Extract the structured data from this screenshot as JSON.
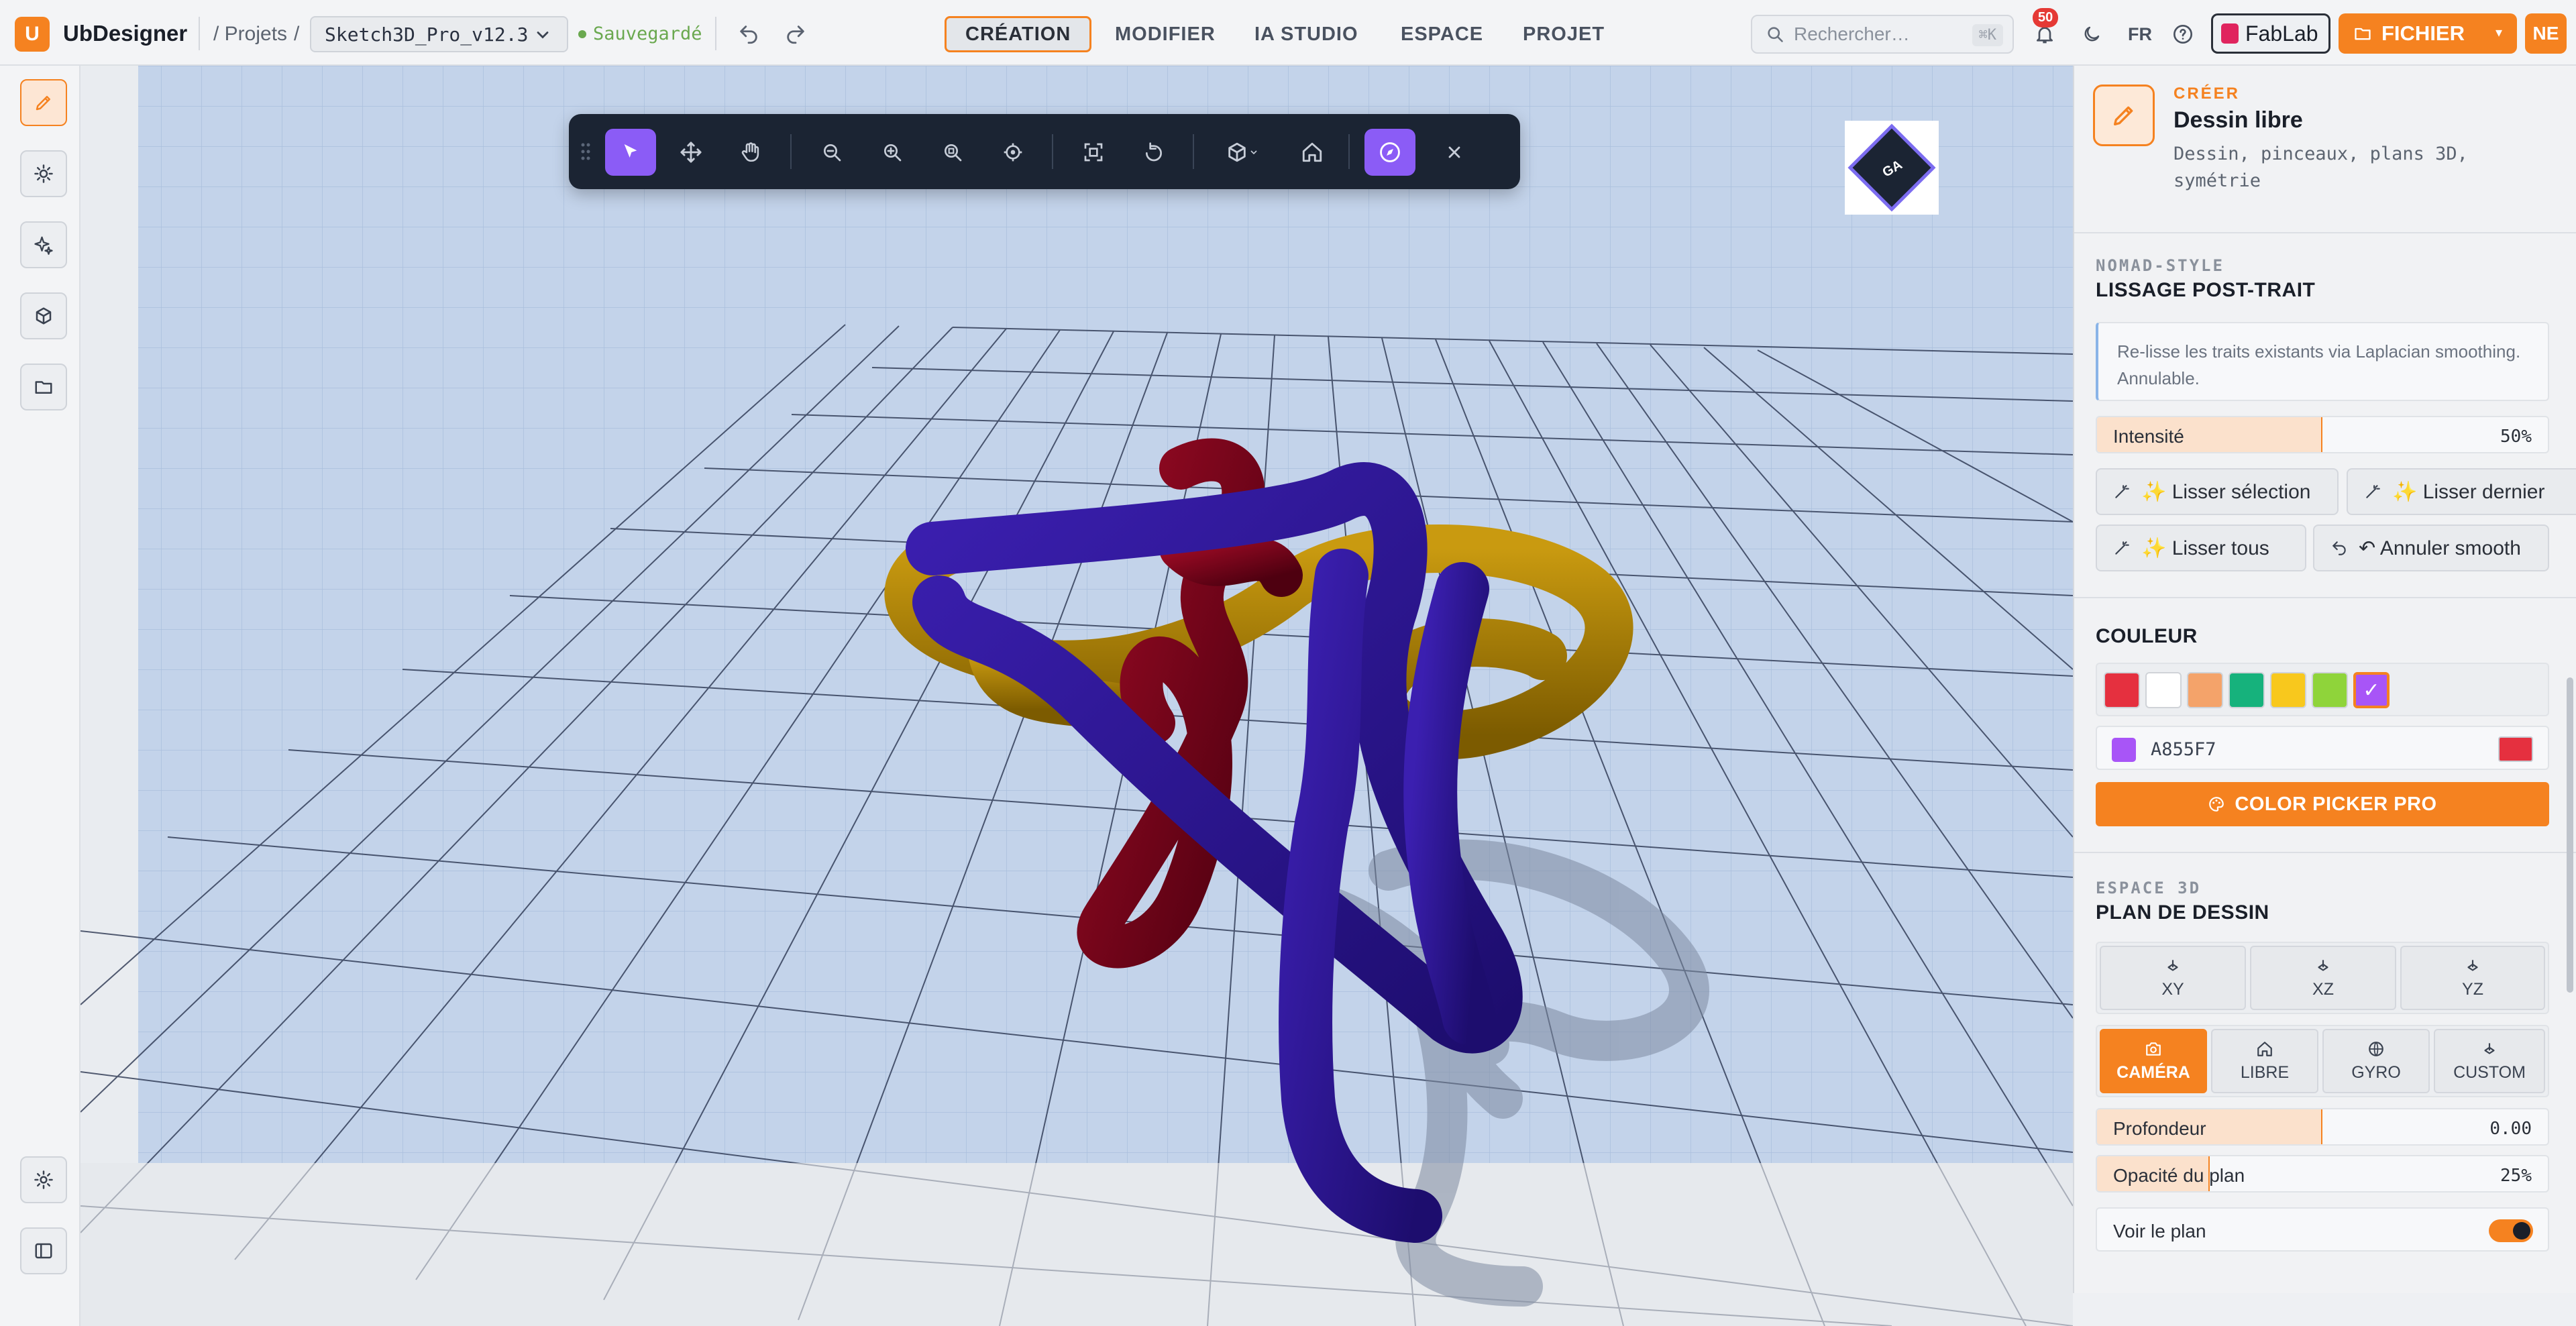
{
  "app": {
    "logo_letter": "U",
    "name": "UbDesigner"
  },
  "breadcrumb": {
    "projects": "/ Projets",
    "sep": "/"
  },
  "file": {
    "name": "Sketch3D_Pro_v12.3",
    "status": "Sauvegardé"
  },
  "nav_tabs": [
    {
      "label": "CRÉATION",
      "active": true
    },
    {
      "label": "MODIFIER",
      "active": false
    },
    {
      "label": "IA STUDIO",
      "active": false
    },
    {
      "label": "ESPACE",
      "active": false
    },
    {
      "label": "PROJET",
      "active": false
    }
  ],
  "search": {
    "placeholder": "Rechercher…",
    "shortcut": "⌘K"
  },
  "notifications": {
    "count": "50"
  },
  "language": "FR",
  "fablab_label": "FabLab",
  "fichier_label": "FICHIER",
  "user_initials": "NE",
  "viewcube_label": "GA",
  "panel": {
    "header": {
      "eyebrow": "CRÉER",
      "title": "Dessin libre",
      "description": "Dessin, pinceaux, plans 3D, symétrie"
    },
    "smoothing": {
      "eyebrow": "NOMAD-STYLE",
      "title": "LISSAGE POST-TRAIT",
      "info": "Re-lisse les traits existants via Laplacian smoothing. Annulable.",
      "intensity_label": "Intensité",
      "intensity_value": "50%",
      "intensity_fraction": 0.5,
      "buttons": [
        {
          "label": "✨ Lisser sélection"
        },
        {
          "label": "✨ Lisser dernier"
        },
        {
          "label": "✨ Lisser tous"
        },
        {
          "label": "↶ Annuler smooth"
        }
      ]
    },
    "color": {
      "title": "COULEUR",
      "swatches": [
        "#e5303f",
        "#ffffff",
        "#f4a36a",
        "#16b27c",
        "#f8c81d",
        "#8fd43a",
        "#a855f7"
      ],
      "selected_check": "✓",
      "hex_value": "A855F7",
      "current_color": "#a855f7",
      "secondary_color": "#e5303f",
      "picker_label": "COLOR PICKER PRO"
    },
    "space3d": {
      "eyebrow": "ESPACE 3D",
      "title": "PLAN DE DESSIN",
      "planes": [
        {
          "label": "XY"
        },
        {
          "label": "XZ"
        },
        {
          "label": "YZ"
        }
      ],
      "modes": [
        {
          "label": "CAMÉRA",
          "selected": true
        },
        {
          "label": "LIBRE",
          "selected": false
        },
        {
          "label": "GYRO",
          "selected": false
        },
        {
          "label": "CUSTOM",
          "selected": false
        }
      ],
      "depth_label": "Profondeur",
      "depth_value": "0.00",
      "depth_fraction": 0.5,
      "opacity_label": "Opacité du plan",
      "opacity_value": "25%",
      "opacity_fraction": 0.25,
      "show_plane_label": "Voir le plan",
      "show_plane_on": true
    }
  },
  "colors": {
    "accent": "#f58220",
    "tool_active": "#8b5cf6",
    "toolbar_bg": "#1b2433"
  }
}
